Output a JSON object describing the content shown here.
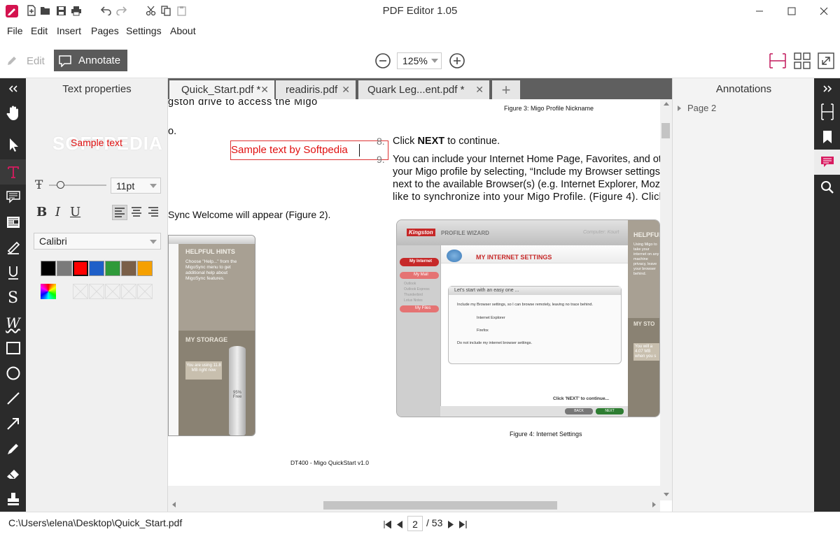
{
  "window": {
    "title": "PDF Editor 1.05"
  },
  "menu": [
    "File",
    "Edit",
    "Insert",
    "Pages",
    "Settings",
    "About"
  ],
  "toolbar": {
    "edit_label": "Edit",
    "annotate_label": "Annotate",
    "zoom_value": "125%"
  },
  "left_panel": {
    "title": "Text properties",
    "sample_text": "Sample text",
    "watermark": "SOFTPEDIA",
    "font_size": "11pt",
    "font_name": "Calibri",
    "format_buttons": [
      "B",
      "I",
      "U"
    ],
    "colors": [
      "#000000",
      "#7a7a7a",
      "#ff0000",
      "#1f5fc8",
      "#2f9a3a",
      "#7a5f48",
      "#f5a000"
    ]
  },
  "tabs": [
    {
      "label": "Quick_Start.pdf *"
    },
    {
      "label": "readiris.pdf"
    },
    {
      "label": "Quark Leg...ent.pdf *"
    }
  ],
  "document": {
    "l1": "gston drive to access the Migo",
    "l2": "o.",
    "l3": "Sync Welcome will appear (Figure 2).",
    "annotation_text": "Sample text by Softpedia",
    "fig3_caption": "Figure 3: Migo Profile Nickname",
    "step8_prefix": "Click ",
    "step8_bold": "NEXT",
    "step8_suffix": " to continue.",
    "step9_line1": "You can include your Internet Home Page, Favorites, and other I",
    "step9_line2": "your Migo profile by selecting, “Include my Browser settings…",
    "step9_line3": "next to the available Browser(s) (e.g. Internet Explorer, Mozill",
    "step9_line4": "like to synchronize into your Migo Profile. (Figure 4). Click",
    "num8": "8.",
    "num9": "9.",
    "fig4_caption": "Figure 4: Internet Settings",
    "footer": "DT400 - Migo QuickStart v1.0",
    "left_shot": {
      "helpful_hints": "HELPFUL HINTS",
      "hints_text": "Choose \"Help...\" from the MigoSync menu to get additional help about MigoSync features.",
      "my_storage": "MY STORAGE",
      "using": "You are using 11.8 MB right now",
      "free": "95% Free"
    },
    "right_shot": {
      "brand": "Kingston",
      "wizard": "PROFILE WIZARD",
      "computer": "Computer: Kourt",
      "heading": "MY INTERNET SETTINGS",
      "nav": [
        "My Internet",
        "My Mail",
        "Outlook",
        "Outlook Express",
        "Thunderbird",
        "Lotus Notes",
        "My Files"
      ],
      "easy": "Let's start with an easy one ...",
      "opt1": "Include my Browser settings, so I can browse remotely, leaving no trace behind.",
      "ie": "Internet Explorer",
      "ff": "Firefox",
      "opt2": "Do not include my internet browser settings.",
      "click_next": "Click 'NEXT' to continue...",
      "back": "BACK",
      "next": "NEXT",
      "helpful": "HELPFUL",
      "my_sto": "MY STO",
      "side_text": "Using Migo to take your internet on any machine privacy, leave your browser behind.",
      "side_val": "You will a 4.07 MB when you s"
    }
  },
  "annotations_panel": {
    "title": "Annotations",
    "item": "Page 2"
  },
  "status": {
    "path": "C:\\Users\\elena\\Desktop\\Quick_Start.pdf",
    "page": "2",
    "total": "/ 53"
  }
}
